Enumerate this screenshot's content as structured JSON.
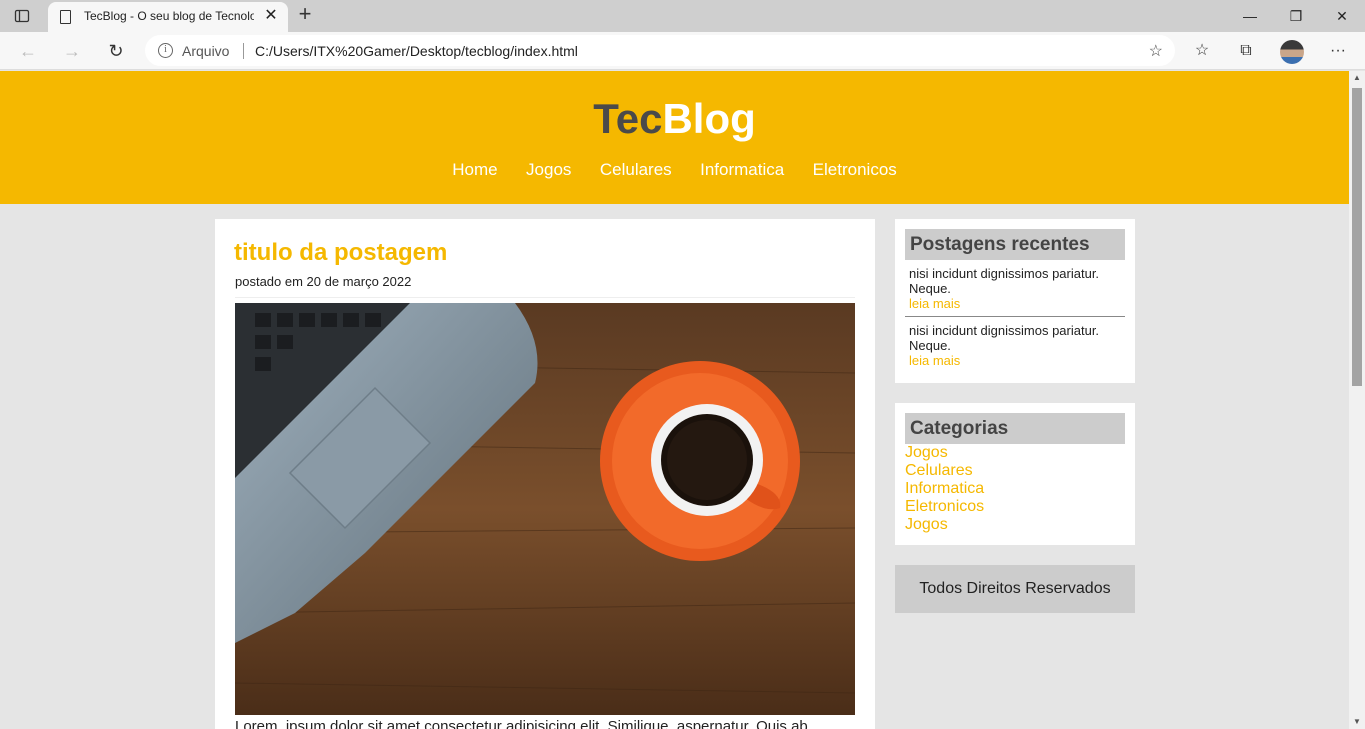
{
  "browser": {
    "tab_title": "TecBlog - O seu blog de Tecnologia",
    "address_label": "Arquivo",
    "url": "C:/Users/ITX%20Gamer/Desktop/tecblog/index.html"
  },
  "site": {
    "logo_part1": "Tec",
    "logo_part2": "Blog",
    "menu": [
      "Home",
      "Jogos",
      "Celulares",
      "Informatica",
      "Eletronicos"
    ],
    "brand_color": "#f5b800"
  },
  "post": {
    "title": "titulo da postagem",
    "date": "postado em 20 de março 2022",
    "text": "Lorem, ipsum dolor sit amet consectetur adipisicing elit. Similique, aspernatur. Quis ab"
  },
  "sidebar": {
    "recent_title": "Postagens recentes",
    "recent": [
      {
        "text": "nisi incidunt dignissimos pariatur. Neque.",
        "link": "leia mais"
      },
      {
        "text": "nisi incidunt dignissimos pariatur. Neque.",
        "link": "leia mais"
      }
    ],
    "categories_title": "Categorias",
    "categories": [
      "Jogos",
      "Celulares",
      "Informatica",
      "Eletronicos",
      "Jogos"
    ],
    "footer": "Todos Direitos Reservados"
  }
}
